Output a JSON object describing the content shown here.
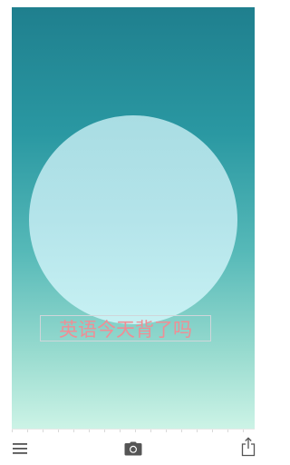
{
  "canvas": {
    "caption": "英语今天背了吗"
  },
  "toolbar": {
    "menu_icon": "hamburger-menu-icon",
    "camera_icon": "camera-icon",
    "share_icon": "share-icon"
  },
  "colors": {
    "gradient_top": "#1f7f8e",
    "gradient_bottom": "#ccf3e6",
    "circle": "#b4e4ea",
    "caption_text": "#ef8e95",
    "icon": "#555555"
  }
}
